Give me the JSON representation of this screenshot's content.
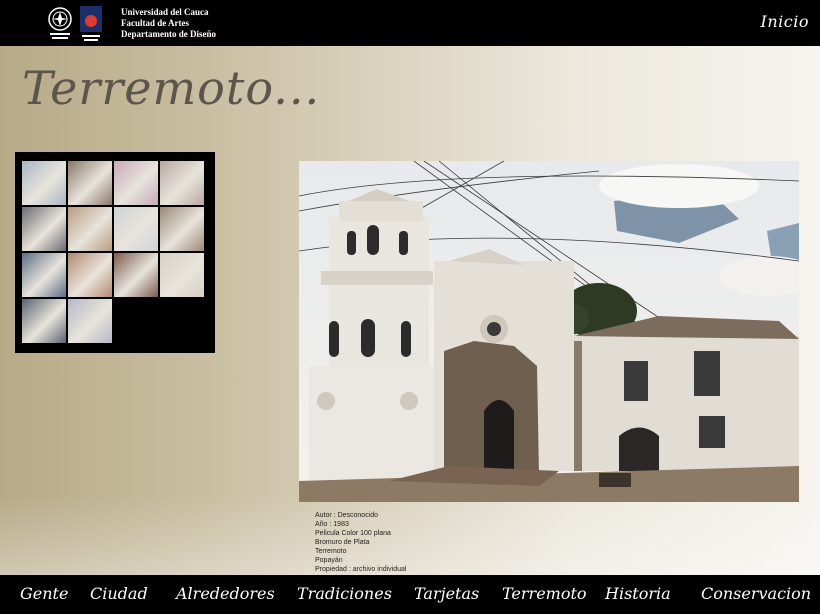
{
  "header": {
    "university_lines": [
      "Universidad del Cauca",
      "Facultad de Artes",
      "Departamento de Diseño"
    ],
    "inicio_label": "Inicio"
  },
  "page": {
    "title": "Terremoto..."
  },
  "thumbnails": {
    "count": 14,
    "palette": [
      "#a8b6c4",
      "#8a7868",
      "#c7a9b8",
      "#b9a7a4",
      "#6a6a70",
      "#b79d7e",
      "#cfd2d6",
      "#9a8876",
      "#5e6c86",
      "#b28a6e",
      "#7c5a4c",
      "#d7cfc4",
      "#5a6270",
      "#b6b8c6"
    ]
  },
  "photo_caption": [
    "Autor :  Desconocido",
    "Año   : 1983",
    "Pelicula Color 100 plana",
    "Bromuro de Plata",
    "Terremoto",
    "Popayán",
    "Propiedad : archivo individual"
  ],
  "nav": {
    "items": [
      "Gente",
      "Ciudad",
      "Alrededores",
      "Tradiciones",
      "Tarjetas",
      "Terremoto",
      "Historia",
      "Conservacion"
    ]
  },
  "colors": {
    "bar_background": "#000000",
    "title_color": "#5c554c",
    "background_gradient_start": "#b7aa88",
    "background_gradient_end": "#f6f4ef"
  }
}
